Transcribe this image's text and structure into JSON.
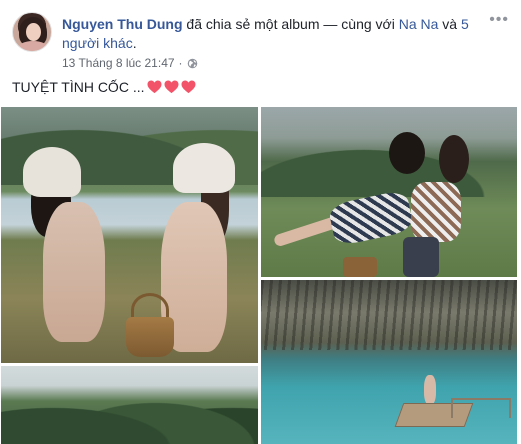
{
  "post": {
    "author": "Nguyen Thu Dung",
    "action_text": " đã chia sẻ một album — cùng với ",
    "tagged_friend": "Na Na",
    "and_text": " và ",
    "others_link": "5 người khác",
    "end_text": ".",
    "timestamp": "13 Tháng 8 lúc 21:47",
    "separator": " · ",
    "privacy_icon": "globe-icon",
    "more_label": "•••",
    "caption": "TUYỆT TÌNH CỐC ...",
    "caption_emoji": [
      "heart-icon",
      "heart-icon",
      "heart-icon"
    ],
    "heart_color": "#f35369"
  },
  "album": {
    "photos": [
      {
        "id": "photo-1",
        "alt": "photo-1"
      },
      {
        "id": "photo-2",
        "alt": "photo-2"
      },
      {
        "id": "photo-3",
        "alt": "photo-3"
      },
      {
        "id": "photo-4",
        "alt": "photo-4"
      }
    ]
  },
  "colors": {
    "link": "#365899",
    "meta": "#616770",
    "text": "#1d2129"
  }
}
